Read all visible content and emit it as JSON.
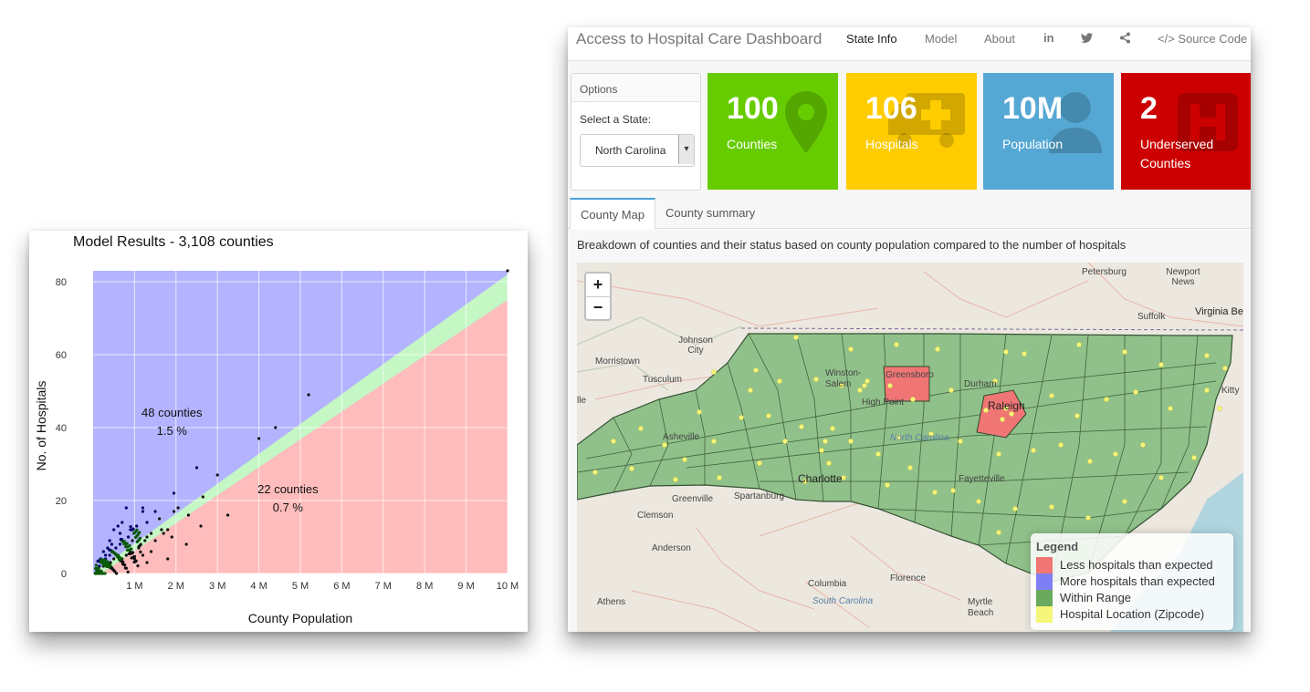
{
  "chart_data": {
    "type": "scatter",
    "title": "Model Results - 3,108 counties",
    "xlabel": "County Population",
    "ylabel": "No. of Hospitals",
    "xlim": [
      0,
      10000000
    ],
    "ylim": [
      0,
      83
    ],
    "x_ticks": [
      1000000,
      2000000,
      3000000,
      4000000,
      5000000,
      6000000,
      7000000,
      8000000,
      9000000,
      10000000
    ],
    "x_tick_labels": [
      "1 M",
      "2 M",
      "3 M",
      "4 M",
      "5 M",
      "6 M",
      "7 M",
      "8 M",
      "9 M",
      "10 M"
    ],
    "y_ticks": [
      0,
      20,
      40,
      60,
      80
    ],
    "y_tick_labels": [
      "0",
      "20",
      "40",
      "60",
      "80"
    ],
    "grid": true,
    "regions": {
      "above": {
        "color": "#b3b3ff"
      },
      "within": {
        "color": "#c4f7c4"
      },
      "below": {
        "color": "#ffbcbc"
      }
    },
    "annotations": [
      {
        "text": "48  counties",
        "x": 1900000,
        "y": 43
      },
      {
        "text": "1.5 %",
        "x": 1900000,
        "y": 38
      },
      {
        "text": "22  counties",
        "x": 4700000,
        "y": 22
      },
      {
        "text": "0.7 %",
        "x": 4700000,
        "y": 17
      }
    ],
    "points": [
      [
        10000000,
        83
      ],
      [
        5200000,
        49
      ],
      [
        4400000,
        40
      ],
      [
        4000000,
        37
      ],
      [
        2500000,
        29
      ],
      [
        2650000,
        21
      ],
      [
        2050000,
        18
      ],
      [
        1950000,
        17
      ],
      [
        3000000,
        27
      ],
      [
        1950000,
        22
      ],
      [
        1200000,
        18
      ],
      [
        800000,
        18
      ],
      [
        1200000,
        17
      ],
      [
        1500000,
        17
      ],
      [
        1600000,
        15
      ],
      [
        1300000,
        14
      ],
      [
        1050000,
        13
      ],
      [
        900000,
        12
      ],
      [
        1100000,
        11
      ],
      [
        700000,
        14
      ],
      [
        600000,
        13
      ],
      [
        650000,
        11
      ],
      [
        500000,
        12
      ],
      [
        400000,
        9
      ],
      [
        450000,
        8
      ],
      [
        350000,
        7
      ],
      [
        250000,
        6
      ],
      [
        3250000,
        16
      ],
      [
        2600000,
        13
      ],
      [
        2300000,
        16
      ],
      [
        2250000,
        8
      ],
      [
        1500000,
        9
      ],
      [
        1900000,
        10
      ],
      [
        1400000,
        6
      ],
      [
        1800000,
        4
      ],
      [
        1300000,
        3
      ],
      [
        900000,
        6
      ],
      [
        1200000,
        5
      ],
      [
        1000000,
        4
      ],
      [
        800000,
        5
      ],
      [
        700000,
        4
      ],
      [
        1100000,
        7
      ],
      [
        1650000,
        12
      ],
      [
        1700000,
        11
      ],
      [
        1800000,
        12
      ],
      [
        1400000,
        11
      ],
      [
        1300000,
        10
      ],
      [
        1250000,
        9
      ],
      [
        950000,
        9
      ],
      [
        850000,
        10
      ],
      [
        700000,
        9
      ],
      [
        650000,
        8
      ],
      [
        550000,
        7
      ],
      [
        450000,
        6
      ],
      [
        600000,
        5
      ],
      [
        500000,
        4
      ],
      [
        350000,
        3
      ],
      [
        300000,
        4
      ],
      [
        200000,
        3
      ],
      [
        150000,
        2
      ],
      [
        100000,
        1
      ],
      [
        250000,
        2
      ],
      [
        180000,
        4
      ],
      [
        300000,
        5
      ],
      [
        400000,
        5
      ],
      [
        420000,
        3
      ]
    ]
  },
  "dashboard": {
    "title": "Access to Hospital Care Dashboard",
    "nav": {
      "state_info": "State Info",
      "model": "Model",
      "about": "About",
      "linkedin_icon": "in",
      "twitter_icon": "twitter-icon",
      "share_icon": "share-icon",
      "source_code": "</> Source Code"
    },
    "options": {
      "title": "Options",
      "select_label": "Select a State:",
      "selected_state": "North Carolina",
      "caret": "▾"
    },
    "value_boxes": [
      {
        "number": "100",
        "label": "Counties",
        "color": "#66cc00",
        "icon": "map-marker-icon"
      },
      {
        "number": "106",
        "label": "Hospitals",
        "color": "#ffcc00",
        "icon": "ambulance-icon"
      },
      {
        "number": "10M",
        "label": "Population",
        "color": "#55a8d4",
        "icon": "user-icon"
      },
      {
        "number": "2",
        "label": "Underserved Counties",
        "color": "#cc0000",
        "icon": "hospital-icon"
      }
    ],
    "tabs": {
      "county_map": "County Map",
      "county_summary": "County summary"
    },
    "description": "Breakdown of counties and their status based on county population compared to the number of hospitals",
    "map": {
      "zoom_in": "+",
      "zoom_out": "−",
      "labels": {
        "petersburg": "Petersburg",
        "newport_news": "Newport News",
        "suffolk": "Suffolk",
        "virginia_beach": "Virginia Bea",
        "johnson_city": "Johnson City",
        "morristown": "Morristown",
        "tusculum": "Tusculum",
        "winston_salem": "Winston-Salem",
        "greensboro": "Greensboro",
        "durham": "Durham",
        "raleigh": "Raleigh",
        "high_point": "High Point",
        "north_carolina": "North Carolina",
        "asheville": "Asheville",
        "charlotte": "Charlotte",
        "fayetteville": "Fayetteville",
        "greenville": "Greenville",
        "spartanburg": "Spartanburg",
        "clemson": "Clemson",
        "anderson": "Anderson",
        "columbia": "Columbia",
        "florence": "Florence",
        "south_carolina": "South Carolina",
        "athens": "Athens",
        "myrtle_beach": "Myrtle Beach",
        "kitty": "Kitty",
        "ille": "lle"
      },
      "legend": {
        "title": "Legend",
        "items": [
          {
            "label": "Less hospitals than expected",
            "color": "#f07575"
          },
          {
            "label": "More hospitals than expected",
            "color": "#7f7ff5"
          },
          {
            "label": "Within Range",
            "color": "#6aaa5e"
          },
          {
            "label": "Hospital Location (Zipcode)",
            "color": "#f5f57a"
          }
        ]
      }
    }
  }
}
